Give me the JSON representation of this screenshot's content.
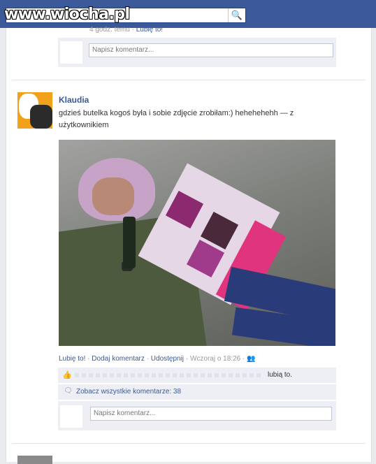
{
  "watermark": "www.wiocha.pl",
  "search": {
    "placeholder": ""
  },
  "post1": {
    "time": "4 godz. temu",
    "like": "Lubię to!",
    "sep": "·",
    "comment_placeholder": "Napisz komentarz..."
  },
  "post2": {
    "author": "Klaudia",
    "text": "gdzieś butelka kogoś była i sobie zdjęcie zrobiłam:) hehehehehh — z użytkownikiem",
    "actions": {
      "like": "Lubię to!",
      "comment": "Dodaj komentarz",
      "share": "Udostępnij",
      "time": "Wczoraj o 18:26",
      "sep": "·"
    },
    "likes_suffix": "lubią to.",
    "view_all": "Zobacz wszystkie komentarze: 38",
    "comment_placeholder": "Napisz komentarz..."
  },
  "colors": {
    "topbar": "#3b5998",
    "link": "#3b5998"
  }
}
